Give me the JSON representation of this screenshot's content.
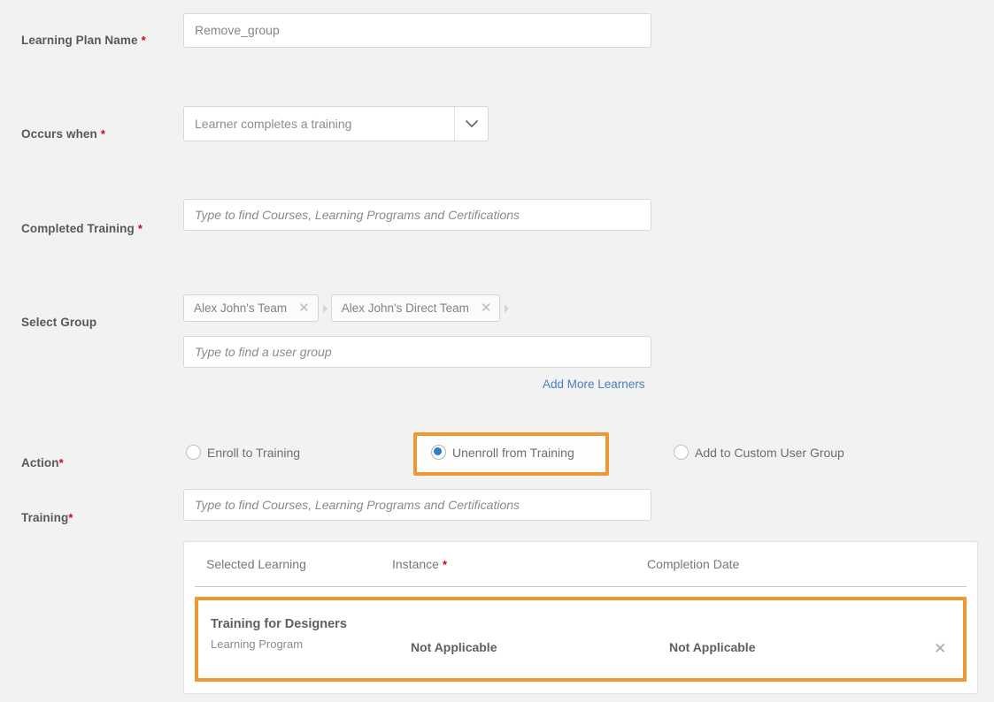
{
  "form": {
    "learning_plan_name": {
      "label": "Learning Plan Name",
      "required_mark": "*",
      "value": "Remove_group"
    },
    "occurs_when": {
      "label": "Occurs when",
      "required_mark": "*",
      "selected": "Learner completes a training",
      "icon": "chevron-down-icon"
    },
    "completed_training": {
      "label": "Completed Training",
      "required_mark": "*",
      "placeholder": "Type to find Courses, Learning Programs and Certifications"
    },
    "select_group": {
      "label": "Select Group",
      "required_mark": "",
      "chips": [
        {
          "label": "Alex John's Team",
          "remove_icon": "close-icon"
        },
        {
          "label": "Alex John's Direct Team",
          "remove_icon": "close-icon"
        }
      ],
      "placeholder": "Type to find a user group",
      "add_more_link": "Add More Learners"
    },
    "action": {
      "label": "Action",
      "required_mark": "*",
      "options": [
        {
          "label": "Enroll to Training",
          "selected": false,
          "highlighted": false
        },
        {
          "label": "Unenroll from Training",
          "selected": true,
          "highlighted": true
        },
        {
          "label": "Add to Custom User Group",
          "selected": false,
          "highlighted": false
        }
      ]
    },
    "training": {
      "label": "Training",
      "required_mark": "*",
      "placeholder": "Type to find Courses, Learning Programs and Certifications"
    }
  },
  "table": {
    "columns": [
      {
        "label": "Selected Learning",
        "required_mark": ""
      },
      {
        "label": "Instance",
        "required_mark": "*"
      },
      {
        "label": "Completion Date",
        "required_mark": ""
      }
    ],
    "rows": [
      {
        "selected_learning": "Training for Designers",
        "selected_learning_type": "Learning Program",
        "instance": "Not Applicable",
        "completion_date": "Not Applicable",
        "remove_icon": "close-icon",
        "highlighted": true
      }
    ]
  },
  "colors": {
    "page_background": "#f2f2f2",
    "highlight_orange": "#ef9733",
    "required_red": "#d0021b",
    "link_blue": "#4a7fc1",
    "radio_selected_blue": "#2a7dd1",
    "label_grey": "#58585a"
  }
}
